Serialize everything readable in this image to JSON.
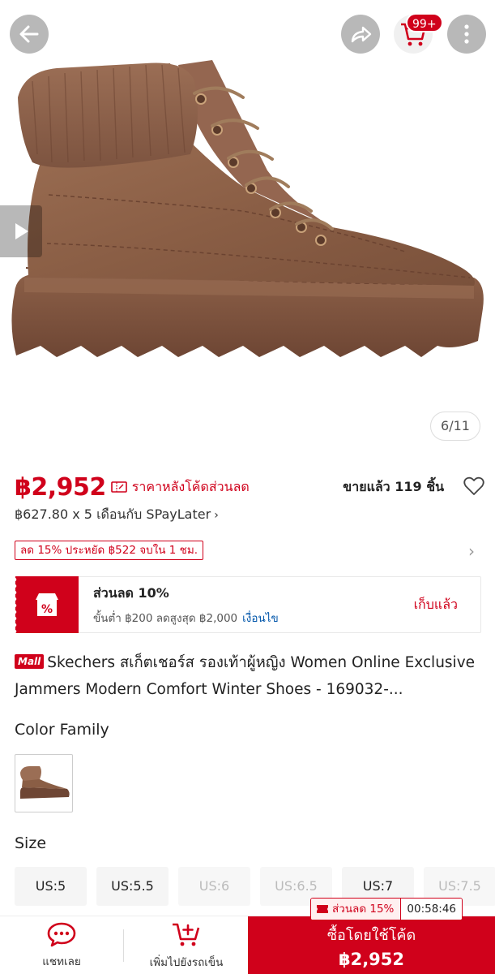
{
  "header": {
    "cart_badge": "99+",
    "image_counter": "6/11"
  },
  "icons": {
    "back": "back-arrow-icon",
    "share": "share-icon",
    "cart": "cart-icon",
    "more": "more-vertical-icon",
    "video": "play-icon",
    "wishlist": "heart-icon",
    "chat": "chat-icon",
    "add_cart": "cart-plus-icon"
  },
  "price": {
    "value": "฿2,952",
    "note": "ราคาหลังโค้ดส่วนลด",
    "sold": "ขายแล้ว 119 ชิ้น",
    "installment": "฿627.80 x 5 เดือนกับ SPayLater",
    "installment_chevron": "›",
    "discount_tag": "ลด 15% ประหยัด ฿522 จบใน 1 ชม.",
    "discount_chevron": "›"
  },
  "voucher": {
    "title": "ส่วนลด 10%",
    "condition": "ขั้นต่ำ ฿200 ลดสูงสุด ฿2,000",
    "condition_link": "เงื่อนไข",
    "action": "เก็บแล้ว"
  },
  "product": {
    "mall_badge": "Mall",
    "title": "Skechers สเก็ตเชอร์ส รองเท้าผู้หญิง Women Online Exclusive Jammers Modern Comfort Winter Shoes - 169032-..."
  },
  "variants": {
    "color_label": "Color Family",
    "size_label": "Size",
    "sizes": [
      {
        "label": "US:5",
        "available": true
      },
      {
        "label": "US:5.5",
        "available": true
      },
      {
        "label": "US:6",
        "available": false
      },
      {
        "label": "US:6.5",
        "available": false
      },
      {
        "label": "US:7",
        "available": true
      },
      {
        "label": "US:7.5",
        "available": false
      }
    ]
  },
  "bottom_bar": {
    "chat_label": "แชทเลย",
    "add_cart_label": "เพิ่มไปยังรถเข็น",
    "buy_label": "ซื้อโดยใช้โค้ด",
    "buy_price": "฿2,952",
    "promo_label": "ส่วนลด 15%",
    "promo_timer": "00:58:46"
  },
  "colors": {
    "brand_red": "#d0011b",
    "boot_brown": "#8a5e45",
    "link_blue": "#0055aa"
  }
}
